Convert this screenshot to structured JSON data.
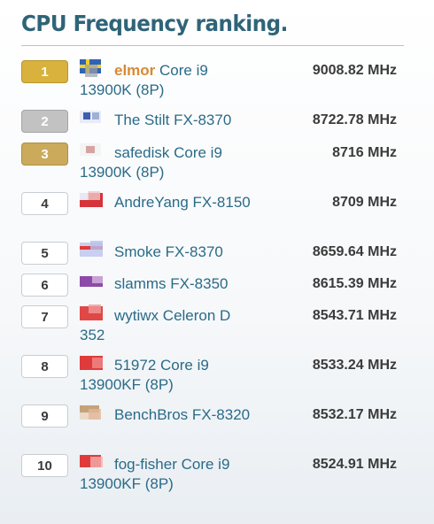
{
  "title": "CPU Frequency ranking.",
  "rows": [
    {
      "rank": "1",
      "user": "elmor",
      "cpu": "Core i9 13900K (8P)",
      "freq": "9008.82 MHz"
    },
    {
      "rank": "2",
      "user": "The Stilt",
      "cpu": "FX-8370",
      "freq": "8722.78 MHz"
    },
    {
      "rank": "3",
      "user": "safedisk",
      "cpu": "Core i9 13900K (8P)",
      "freq": "8716 MHz"
    },
    {
      "rank": "4",
      "user": "AndreYang",
      "cpu": "FX-8150",
      "freq": "8709 MHz"
    },
    {
      "rank": "5",
      "user": "Smoke",
      "cpu": "FX-8370",
      "freq": "8659.64 MHz"
    },
    {
      "rank": "6",
      "user": "slamms",
      "cpu": "FX-8350",
      "freq": "8615.39 MHz"
    },
    {
      "rank": "7",
      "user": "wytiwx",
      "cpu": "Celeron D 352",
      "freq": "8543.71 MHz"
    },
    {
      "rank": "8",
      "user": "51972",
      "cpu": "Core i9 13900KF (8P)",
      "freq": "8533.24 MHz"
    },
    {
      "rank": "9",
      "user": "BenchBros",
      "cpu": "FX-8320",
      "freq": "8532.17 MHz"
    },
    {
      "rank": "10",
      "user": "fog-fisher",
      "cpu": "Core i9 13900KF (8P)",
      "freq": "8524.91 MHz"
    }
  ],
  "colors": {
    "title": "#2f6478",
    "link": "#2a6b88",
    "highlight_user": "#d98933",
    "gold": "#d8b23d",
    "silver": "#c2c2c2",
    "bronze": "#cbaa5c"
  },
  "flag_icons": [
    "sweden-flag-icon",
    "flag-icon",
    "flag-icon",
    "flag-icon",
    "flag-icon",
    "flag-icon",
    "flag-icon",
    "flag-icon",
    "flag-icon",
    "flag-icon"
  ]
}
